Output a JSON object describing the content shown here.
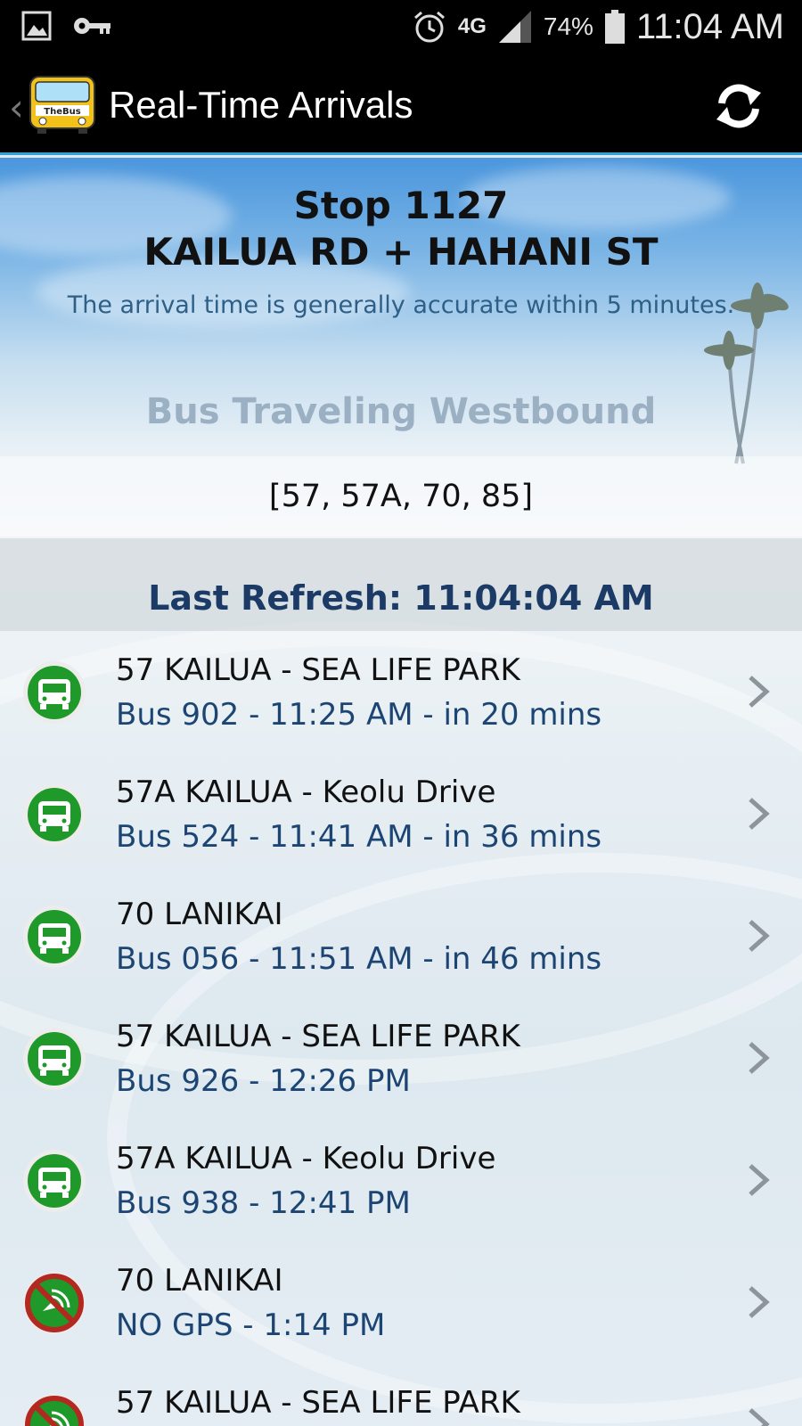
{
  "status_bar": {
    "time": "11:04 AM",
    "battery_percent": "74%",
    "network": "4G",
    "icons": [
      "gallery-icon",
      "key-icon",
      "alarm-icon",
      "network-4g-icon",
      "signal-icon",
      "battery-icon"
    ]
  },
  "action_bar": {
    "title": "Real-Time Arrivals",
    "logo_text": "TheBus",
    "icons": [
      "back-chevron-icon",
      "bus-logo-icon",
      "refresh-icon"
    ]
  },
  "stop": {
    "number": "Stop 1127",
    "name": "KAILUA RD + HAHANI ST",
    "accuracy_note": "The arrival time is generally accurate within 5 minutes."
  },
  "direction": "Bus Traveling Westbound",
  "routes": "[57, 57A, 70, 85]",
  "last_refresh": "Last Refresh: 11:04:04 AM",
  "arrivals": [
    {
      "route": "57 KAILUA - SEA LIFE PARK",
      "detail": "Bus 902 - 11:25 AM - in 20 mins",
      "icon": "bus-gps-icon"
    },
    {
      "route": "57A KAILUA - Keolu Drive",
      "detail": "Bus 524 - 11:41 AM - in 36 mins",
      "icon": "bus-gps-icon"
    },
    {
      "route": "70 LANIKAI",
      "detail": "Bus 056 - 11:51 AM - in 46 mins",
      "icon": "bus-gps-icon"
    },
    {
      "route": "57 KAILUA - SEA LIFE PARK",
      "detail": "Bus 926 - 12:26 PM",
      "icon": "bus-gps-icon"
    },
    {
      "route": "57A KAILUA - Keolu Drive",
      "detail": "Bus 938 - 12:41 PM",
      "icon": "bus-gps-icon"
    },
    {
      "route": "70 LANIKAI",
      "detail": "NO GPS - 1:14 PM",
      "icon": "no-gps-icon"
    },
    {
      "route": "57 KAILUA - SEA LIFE PARK",
      "detail": "",
      "icon": "no-gps-icon"
    }
  ],
  "colors": {
    "status_bar_bg": "#000000",
    "action_bar_accent": "#2aa4d9",
    "refresh_text": "#1b3a66",
    "detail_text": "#1d4573",
    "gps_icon_green": "#1f9a2a",
    "no_gps_red": "#b32820"
  }
}
